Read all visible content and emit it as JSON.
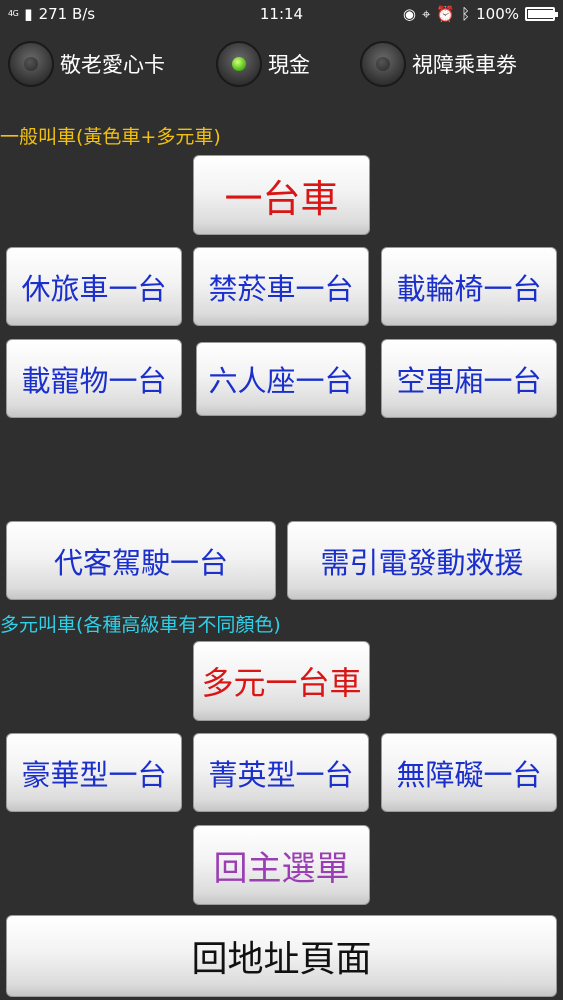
{
  "status_bar": {
    "network": "4G",
    "speed": "271 B/s",
    "time": "11:14",
    "battery": "100%",
    "battery_level": 1.0
  },
  "payment_options": [
    {
      "label": "敬老愛心卡",
      "selected": false
    },
    {
      "label": "現金",
      "selected": true
    },
    {
      "label": "視障乘車劵",
      "selected": false
    }
  ],
  "general": {
    "heading": "一般叫車(黃色車+多元車)",
    "heading_color": "#f2c010",
    "main_button": "一台車",
    "buttons": [
      "休旅車一台",
      "禁菸車一台",
      "載輪椅一台",
      "載寵物一台",
      "六人座一台",
      "空車廂一台"
    ]
  },
  "extra_buttons": [
    "代客駕駛一台",
    "需引電發動救援"
  ],
  "multi": {
    "heading": "多元叫車(各種高級車有不同顏色)",
    "heading_color": "#2fd0e8",
    "main_button": "多元一台車",
    "buttons": [
      "豪華型一台",
      "菁英型一台",
      "無障礙一台"
    ]
  },
  "back_menu": "回主選單",
  "back_address": "回地址頁面",
  "colors": {
    "background": "#2f2f2f",
    "button_blue_text": "#1a2fcc",
    "button_red_text": "#d91515",
    "button_purple_text": "#9a3fb3",
    "radio_selected": "#56c21d"
  }
}
